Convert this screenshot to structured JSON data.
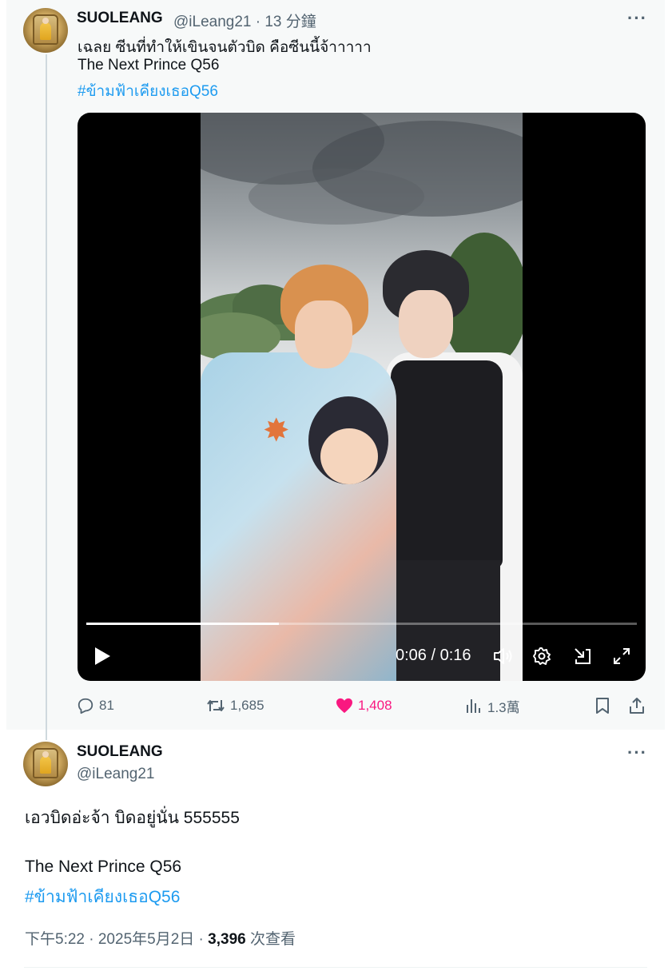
{
  "post1": {
    "name": "SUOLEANG",
    "handle_time": "@iLeang21 · 13 分鐘",
    "more": "···",
    "lines": [
      "เฉลย ซีนที่ทำให้เขินจนตัวบิด คือซีนนี้จ้าาาาา",
      "The Next Prince Q56"
    ],
    "hashtag": "#ข้ามฟ้าเคียงเธอQ56",
    "video": {
      "progress": 0.35,
      "time": "0:06 / 0:16",
      "play_icon": "play-icon",
      "volume_icon": "volume-icon",
      "settings_icon": "gear-icon",
      "pip_icon": "pip-icon",
      "fullscreen_icon": "fullscreen-icon"
    },
    "actions": {
      "replies": "81",
      "reposts": "1,685",
      "likes": "1,408",
      "views": "1.3萬"
    },
    "colors": {
      "like": "#f91880",
      "link": "#1d9bf0",
      "muted": "#536471"
    }
  },
  "post2": {
    "name": "SUOLEANG",
    "handle": "@iLeang21",
    "more": "···",
    "line1": "เอวบิดอ่ะจ้า บิดอยู่นั่น 555555",
    "line2": "The Next Prince Q56",
    "hashtag": "#ข้ามฟ้าเคียงเธอQ56",
    "meta_time": "下午5:22 · 2025年5月2日 · ",
    "meta_views": "3,396",
    "meta_views_label": " 次查看"
  }
}
